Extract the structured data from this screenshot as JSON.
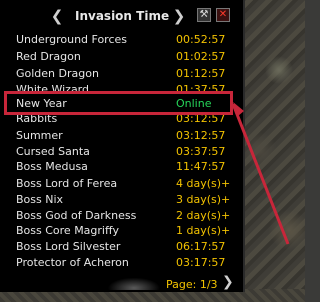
{
  "header": {
    "title": "Invasion Time",
    "prev_icon": "chevron-left-icon",
    "next_icon": "chevron-right-icon",
    "settings_icon": "wrench-icon",
    "close_icon": "close-icon"
  },
  "rows": [
    {
      "name": "Underground Forces",
      "time": "00:52:57"
    },
    {
      "name": "Red Dragon",
      "time": "01:02:57"
    },
    {
      "name": "Golden Dragon",
      "time": "01:12:57"
    },
    {
      "name": "White Wizard",
      "time": "01:37:57"
    },
    {
      "name": "New Year",
      "time": "Online"
    },
    {
      "name": "Rabbits",
      "time": "03:12:57"
    },
    {
      "name": "Summer",
      "time": "03:12:57"
    },
    {
      "name": "Cursed Santa",
      "time": "03:37:57"
    },
    {
      "name": "Boss Medusa",
      "time": "11:47:57"
    },
    {
      "name": "Boss Lord of Ferea",
      "time": "4 day(s)+"
    },
    {
      "name": "Boss Nix",
      "time": "3 day(s)+"
    },
    {
      "name": "Boss God of Darkness",
      "time": "2 day(s)+"
    },
    {
      "name": "Boss Core Magriffy",
      "time": "1 day(s)+"
    },
    {
      "name": "Boss Lord Silvester",
      "time": "06:17:57"
    },
    {
      "name": "Protector of Acheron",
      "time": "03:17:57"
    }
  ],
  "footer": {
    "page_label": "Page: 1/3",
    "next_icon": "chevron-right-icon"
  },
  "colors": {
    "time": "#f2c200",
    "online": "#26d65a",
    "highlight": "#c8263a"
  }
}
